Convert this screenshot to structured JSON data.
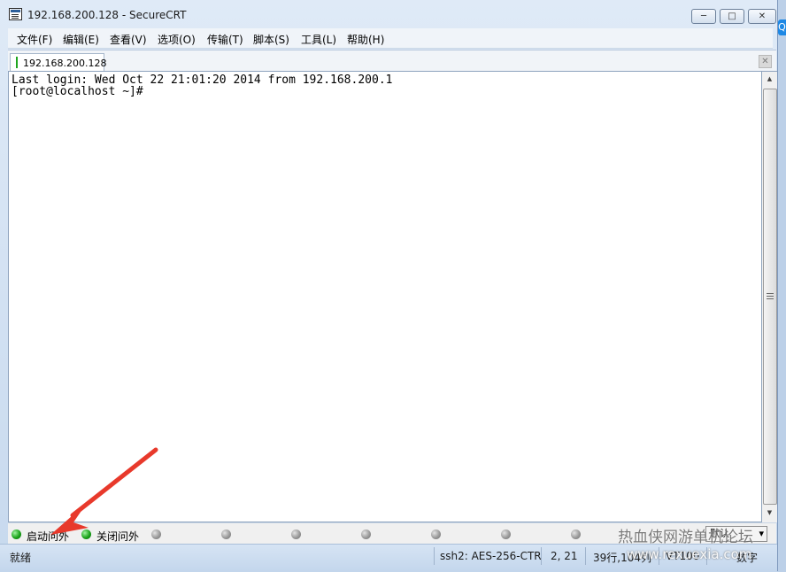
{
  "window": {
    "title": "192.168.200.128 - SecureCRT",
    "icon": "securecrt-app-icon",
    "controls": {
      "minimize": "─",
      "maximize": "□",
      "close": "✕"
    }
  },
  "menubar": {
    "items": [
      "文件(F)",
      "编辑(E)",
      "查看(V)",
      "选项(O)",
      "传输(T)",
      "脚本(S)",
      "工具(L)",
      "帮助(H)"
    ]
  },
  "tabs": {
    "active": {
      "label": "192.168.200.128",
      "status_color": "#1fa61f"
    },
    "close": "✕"
  },
  "terminal": {
    "lines": [
      "Last login: Wed Oct 22 21:01:20 2014 from 192.168.200.1",
      "[root@localhost ~]#"
    ]
  },
  "buttonbar": {
    "buttons": [
      {
        "label": "启动问外",
        "led": "green"
      },
      {
        "label": "关闭问外",
        "led": "green"
      }
    ],
    "empty_led_count": 7,
    "menu_button_label": "默认"
  },
  "statusbar": {
    "ready": "就绪",
    "cipher": "ssh2: AES-256-CTR",
    "cursor": "2,  21",
    "size": "39行,104列",
    "terminal_type": "VT100",
    "caps": "数字"
  },
  "watermark": {
    "text": "热血侠网游单机论坛",
    "url": "www.rexuexia.com"
  },
  "annotation": {
    "color": "#e8392b"
  },
  "right_edge_badge": "Q"
}
